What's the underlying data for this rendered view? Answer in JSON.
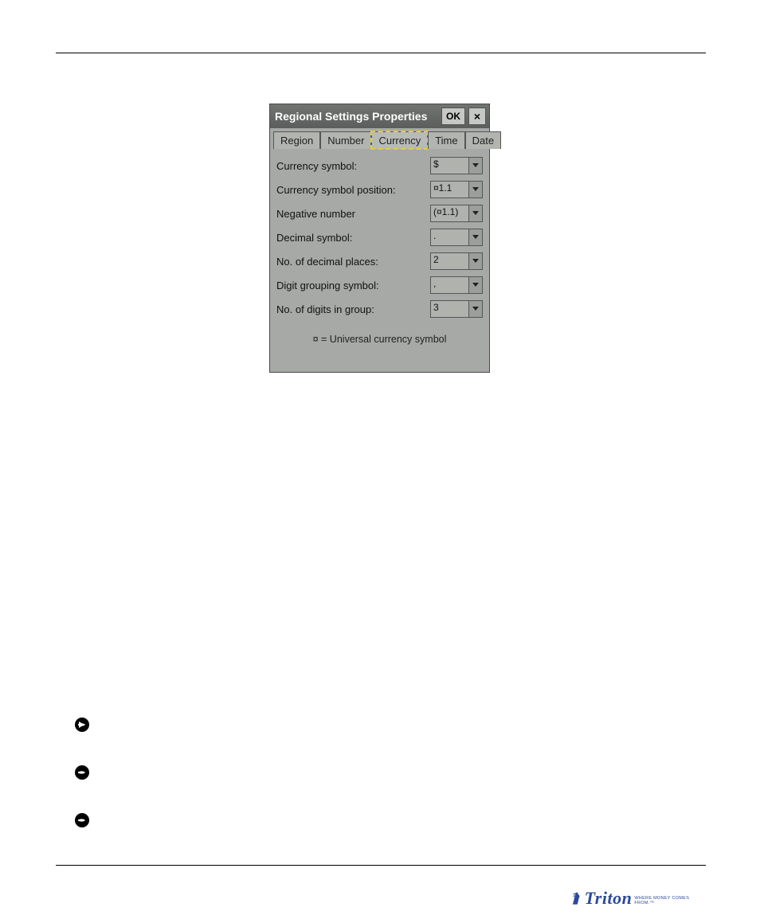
{
  "dialog": {
    "title": "Regional Settings Properties",
    "ok": "OK",
    "close": "×",
    "tabs": [
      "Region",
      "Number",
      "Currency",
      "Time",
      "Date"
    ],
    "active_tab": 2,
    "rows": [
      {
        "label": "Currency symbol:",
        "value": "$"
      },
      {
        "label": "Currency symbol position:",
        "value": "¤1.1"
      },
      {
        "label": "Negative number",
        "value": "(¤1.1)"
      },
      {
        "label": "Decimal symbol:",
        "value": "."
      },
      {
        "label": "No. of decimal places:",
        "value": "2"
      },
      {
        "label": "Digit grouping symbol:",
        "value": ","
      },
      {
        "label": "No. of digits in group:",
        "value": "3"
      }
    ],
    "footnote": "¤ = Universal currency symbol"
  },
  "logo": {
    "brand": "Triton",
    "tagline": "WHERE MONEY COMES FROM.™"
  }
}
